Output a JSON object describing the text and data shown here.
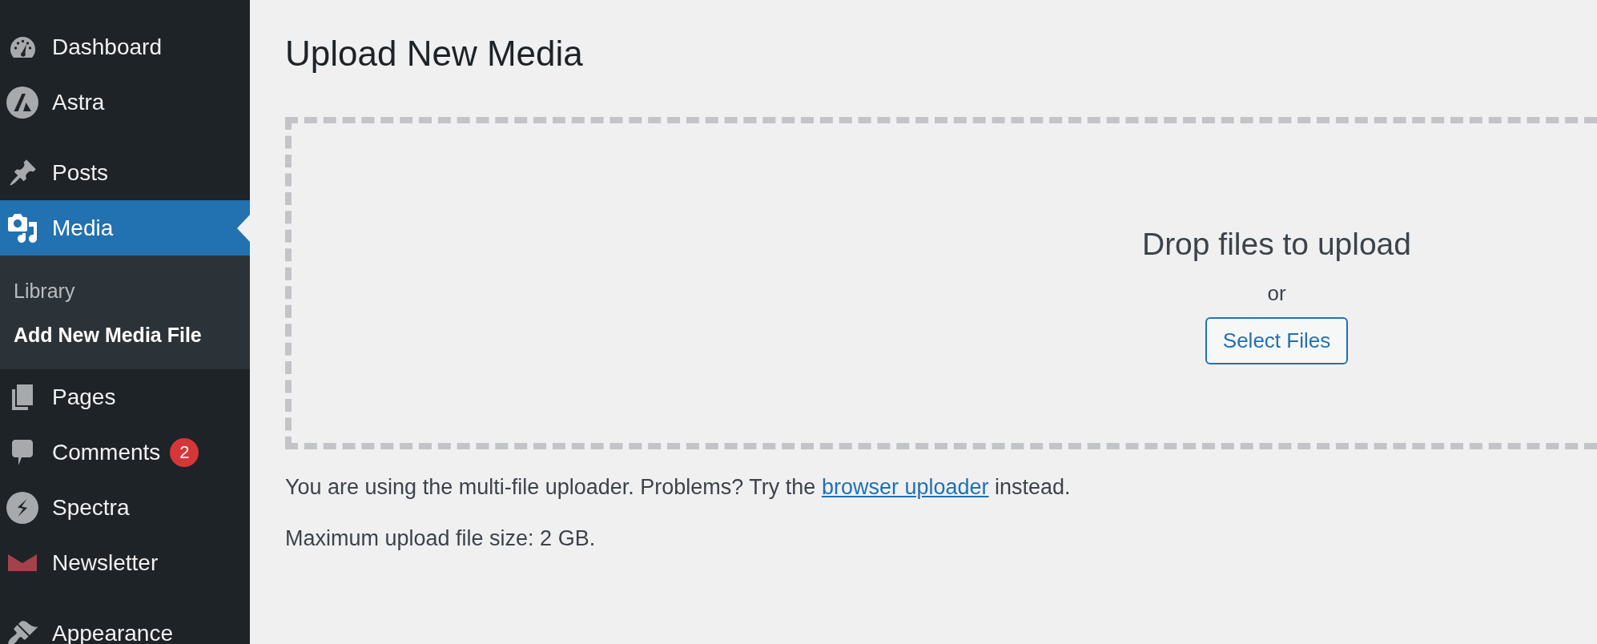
{
  "sidebar": {
    "sections": [
      {
        "items": [
          {
            "label": "Dashboard",
            "selected": false
          },
          {
            "label": "Astra",
            "selected": false
          }
        ]
      },
      {
        "items": [
          {
            "label": "Posts",
            "selected": false
          },
          {
            "label": "Media",
            "selected": true,
            "submenu": [
              {
                "label": "Library",
                "selected": false
              },
              {
                "label": "Add New Media File",
                "selected": true
              }
            ]
          },
          {
            "label": "Pages",
            "selected": false
          },
          {
            "label": "Comments",
            "selected": false,
            "badge": "2"
          },
          {
            "label": "Spectra",
            "selected": false
          },
          {
            "label": "Newsletter",
            "selected": false
          }
        ]
      },
      {
        "items": [
          {
            "label": "Appearance",
            "selected": false
          }
        ]
      }
    ]
  },
  "page_title": "Upload New Media",
  "drop_zone": {
    "heading": "Drop files to upload",
    "separator": "or",
    "button": "Select Files"
  },
  "notes": [
    {
      "text": "You are using the multi-file uploader. Problems? Try the",
      "link": "browser uploader",
      "text_after": "instead."
    },
    {
      "text": "Maximum upload file size: 2 GB."
    }
  ]
}
